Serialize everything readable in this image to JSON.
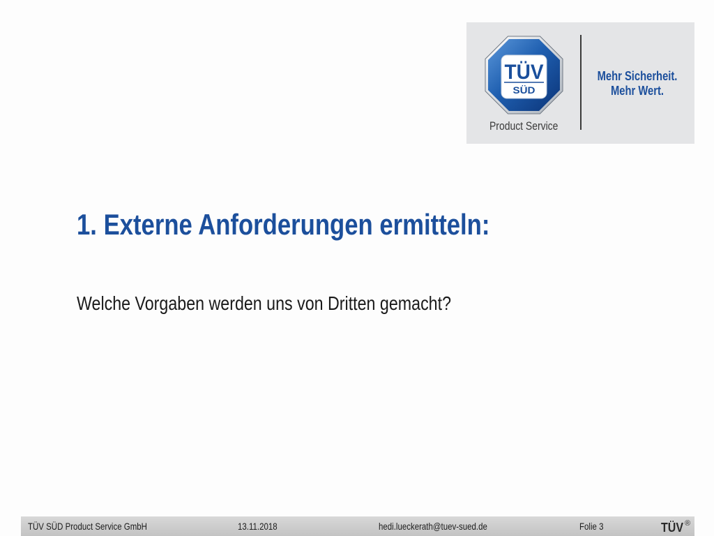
{
  "colors": {
    "brand_blue": "#1c4f9c",
    "body_text": "#1a1a1a",
    "logo_panel": "#e4e5e7",
    "footer_text": "#1e1e1e"
  },
  "logo": {
    "mark_top": "TÜV",
    "mark_bottom": "SÜD",
    "division": "Product Service",
    "claim_line1": "Mehr Sicherheit.",
    "claim_line2": "Mehr Wert."
  },
  "slide": {
    "title": "1. Externe Anforderungen ermitteln:",
    "body": "Welche Vorgaben werden uns von Dritten gemacht?"
  },
  "footer": {
    "company": "TÜV SÜD Product Service GmbH",
    "date": "13.11.2018",
    "email": "hedi.lueckerath@tuev-sued.de",
    "slide_number": "Folie 3",
    "logo_text": "TÜV",
    "logo_registered": "®"
  }
}
